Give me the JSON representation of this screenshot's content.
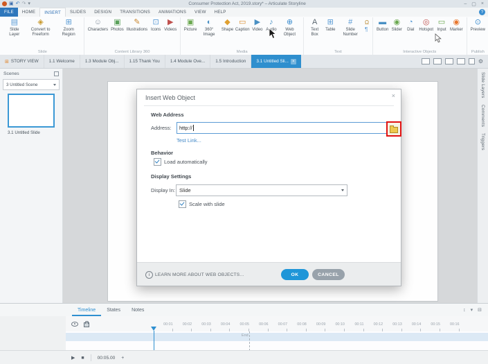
{
  "titlebar": {
    "title": "Consumer Protection Act, 2019.story* – Articulate Storyline"
  },
  "ribbon": {
    "tabs": [
      {
        "label": "FILE",
        "cls": "file"
      },
      {
        "label": "HOME"
      },
      {
        "label": "INSERT",
        "cls": "active"
      },
      {
        "label": "SLIDES"
      },
      {
        "label": "DESIGN"
      },
      {
        "label": "TRANSITIONS"
      },
      {
        "label": "ANIMATIONS"
      },
      {
        "label": "VIEW"
      },
      {
        "label": "HELP"
      }
    ],
    "groups": {
      "slide": {
        "label": "Slide",
        "items": [
          {
            "label": "Slide Layer",
            "icon": "slide-layer-icon"
          },
          {
            "label": "Convert to Freeform",
            "icon": "convert-freeform-icon"
          },
          {
            "label": "Zoom Region",
            "icon": "zoom-region-icon"
          }
        ]
      },
      "content": {
        "label": "Content Library 360",
        "items": [
          {
            "label": "Characters",
            "icon": "characters-icon"
          },
          {
            "label": "Photos",
            "icon": "photos-icon"
          },
          {
            "label": "Illustrations",
            "icon": "illustrations-icon"
          },
          {
            "label": "Icons",
            "icon": "icons-icon"
          },
          {
            "label": "Videos",
            "icon": "videos-icon"
          }
        ]
      },
      "media": {
        "label": "Media",
        "items": [
          {
            "label": "Picture",
            "icon": "picture-icon"
          },
          {
            "label": "360° Image",
            "icon": "image-360-icon"
          },
          {
            "label": "Shape",
            "icon": "shape-icon"
          },
          {
            "label": "Caption",
            "icon": "caption-icon"
          },
          {
            "label": "Video",
            "icon": "video-icon"
          },
          {
            "label": "Audio",
            "icon": "audio-icon"
          },
          {
            "label": "Web Object",
            "icon": "web-object-icon"
          }
        ]
      },
      "text": {
        "label": "Text",
        "items": [
          {
            "label": "Text Box",
            "icon": "text-box-icon"
          },
          {
            "label": "Table",
            "icon": "table-icon"
          },
          {
            "label": "Slide Number",
            "icon": "slide-number-icon"
          }
        ],
        "extra": [
          {
            "icon": "symbol-icon"
          },
          {
            "icon": "reference-icon"
          }
        ]
      },
      "interactive": {
        "label": "Interactive Objects",
        "items": [
          {
            "label": "Button",
            "icon": "button-icon"
          },
          {
            "label": "Slider",
            "icon": "slider-icon"
          },
          {
            "label": "Dial",
            "icon": "dial-icon"
          },
          {
            "label": "Hotspot",
            "icon": "hotspot-icon"
          },
          {
            "label": "Input",
            "icon": "input-icon"
          },
          {
            "label": "Marker",
            "icon": "marker-icon"
          }
        ]
      },
      "publish": {
        "label": "Publish",
        "items": [
          {
            "label": "Preview",
            "icon": "preview-icon"
          }
        ]
      }
    }
  },
  "doc_tabs": {
    "story_view": "STORY VIEW",
    "items": [
      {
        "label": "1.1 Welcome"
      },
      {
        "label": "1.3 Module Obj..."
      },
      {
        "label": "1.15 Thank You"
      },
      {
        "label": "1.4 Module Ove..."
      },
      {
        "label": "1.5 Introduction"
      }
    ],
    "active_label": "3.1 Untitled Sli...",
    "active_close": "×"
  },
  "scenes": {
    "title": "Scenes",
    "selector": "3 Untitled Scene",
    "slide_label": "3.1 Untitled Slide"
  },
  "dialog": {
    "title": "Insert Web Object",
    "close": "×",
    "web_address_heading": "Web Address",
    "address_label": "Address:",
    "address_value": "http://",
    "test_link": "Test Link...",
    "behavior_heading": "Behavior",
    "load_automatically_label": "Load automatically",
    "display_heading": "Display Settings",
    "display_in_label": "Display In:",
    "display_in_value": "Slide",
    "scale_label": "Scale with slide",
    "info_glyph": "i",
    "learn_more": "LEARN MORE ABOUT WEB OBJECTS...",
    "ok_label": "OK",
    "cancel_label": "CANCEL"
  },
  "side_panels": [
    "Slide Layers",
    "Comments",
    "Triggers"
  ],
  "timeline": {
    "tabs": [
      {
        "label": "Timeline",
        "cls": "active"
      },
      {
        "label": "States"
      },
      {
        "label": "Notes"
      }
    ],
    "ticks": [
      "00:01",
      "00:02",
      "00:03",
      "00:04",
      "00:05",
      "00:06",
      "00:07",
      "00:08",
      "00:09",
      "00:10",
      "00:11",
      "00:12",
      "00:13",
      "00:14",
      "00:15",
      "00:16"
    ],
    "end_label": "End",
    "time_display": "00:05.00"
  }
}
